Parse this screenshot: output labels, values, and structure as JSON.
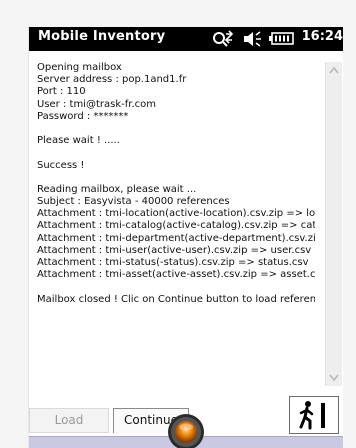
{
  "window": {
    "app_title": "Mobile Inventory",
    "clock": "16:24"
  },
  "status_icons": [
    "connectivity-icon",
    "speaker-icon",
    "battery-icon"
  ],
  "log": {
    "lines": [
      "Opening mailbox",
      "Server address : pop.1and1.fr",
      "Port  : 110",
      "User : tmi@trask-fr.com",
      "Password : *******",
      "",
      "Please wait ! .....",
      "",
      "Success !",
      "",
      "Reading mailbox, please wait ...",
      "Subject : Easyvista - 40000 references",
      "Attachment : tmi-location(active-location).csv.zip => loc",
      "Attachment : tmi-catalog(active-catalog).csv.zip => cata",
      "Attachment : tmi-department(active-department).csv.zip",
      "Attachment : tmi-user(active-user).csv.zip => user.csv",
      "Attachment : tmi-status(-status).csv.zip => status.csv",
      "Attachment : tmi-asset(active-asset).csv.zip => asset.csv",
      "",
      "Mailbox closed ! Clic on Continue button to load referen"
    ]
  },
  "buttons": {
    "load_label": "Load",
    "continue_label": "Continue"
  },
  "colors": {
    "titlebar_bg": "#000000",
    "bottom_strip": "#c9c9e4",
    "exit_figure": "#000000",
    "orb_accent": "#f08a12"
  }
}
